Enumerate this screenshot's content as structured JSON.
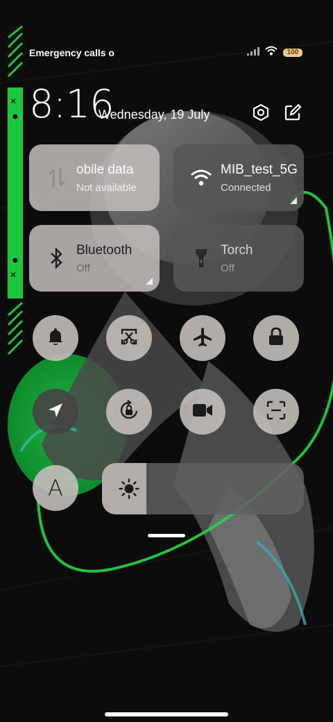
{
  "status_bar": {
    "carrier_text": "Emergency calls o",
    "battery_level": "100",
    "icons": [
      "signal-icon",
      "wifi-icon",
      "battery-icon"
    ]
  },
  "header": {
    "time": "8:16",
    "date": "Wednesday, 19 July",
    "buttons": [
      "settings-icon",
      "edit-icon"
    ]
  },
  "tiles": [
    {
      "name": "mobile-data",
      "title": "obile data",
      "subtitle": "Not available",
      "icon": "data-arrows-icon",
      "state": "unavailable"
    },
    {
      "name": "wifi",
      "title": "MIB_test_5G",
      "subtitle": "Connected",
      "icon": "wifi-icon",
      "state": "on"
    },
    {
      "name": "bluetooth",
      "title": "Bluetooth",
      "subtitle": "Off",
      "icon": "bluetooth-icon",
      "state": "off"
    },
    {
      "name": "torch",
      "title": "Torch",
      "subtitle": "Off",
      "icon": "torch-icon",
      "state": "off"
    }
  ],
  "round_buttons": [
    {
      "name": "silent-mode",
      "icon": "bell-icon"
    },
    {
      "name": "screenshot",
      "icon": "scissors-screenshot-icon"
    },
    {
      "name": "airplane-mode",
      "icon": "airplane-icon"
    },
    {
      "name": "lock-screen",
      "icon": "lock-icon"
    },
    {
      "name": "location",
      "icon": "location-arrow-icon",
      "active": true
    },
    {
      "name": "rotation-lock",
      "icon": "rotation-lock-icon"
    },
    {
      "name": "screen-recorder",
      "icon": "video-camera-icon"
    },
    {
      "name": "scanner",
      "icon": "scan-icon"
    },
    {
      "name": "auto-brightness",
      "icon": "letter-a-icon",
      "label": "A"
    }
  ],
  "brightness": {
    "icon": "sun-icon",
    "level_percent": 22
  },
  "colors": {
    "accent_green": "#18c23b",
    "tile_light": "#c4beba",
    "tile_dark": "#565454",
    "battery": "#f2c98c"
  }
}
